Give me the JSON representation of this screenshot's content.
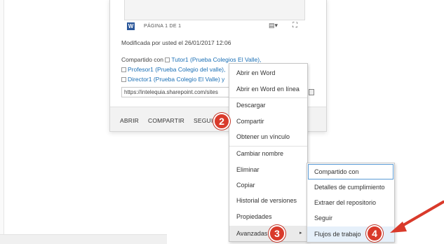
{
  "card": {
    "page_label": "PÁGINA 1 DE 1",
    "modified": "Modificada por usted el 26/01/2017 12:06",
    "shared_prefix": "Compartido con",
    "people": [
      "Tutor1 (Prueba Colegios El Valle),",
      "Profesor1 (Prueba Colegio del valle),",
      "Director1 (Prueba Colegio El Valle) y"
    ],
    "url": "https://intelequia.sharepoint.com/sites"
  },
  "actions": {
    "open": "ABRIR",
    "share": "COMPARTIR",
    "follow": "SEGUIR"
  },
  "menu": {
    "items": [
      "Abrir en Word",
      "Abrir en Word en línea",
      "Descargar",
      "Compartir",
      "Obtener un vínculo",
      "Cambiar nombre",
      "Eliminar",
      "Copiar",
      "Historial de versiones",
      "Propiedades",
      "Avanzadas"
    ],
    "submenu_arrow": "▸"
  },
  "submenu": {
    "items": [
      "Compartido con",
      "Detalles de cumplimiento",
      "Extraer del repositorio",
      "Seguir",
      "Flujos de trabajo"
    ]
  },
  "badges": [
    "2",
    "3",
    "4"
  ],
  "colors": {
    "badge": "#d93a2b",
    "link": "#1a6fb5",
    "arrow": "#d93a2b",
    "word": "#2b579a",
    "focus": "#5b9bd5"
  }
}
